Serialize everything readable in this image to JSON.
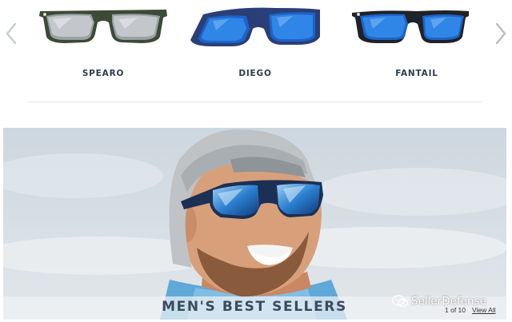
{
  "carousel": {
    "products": [
      {
        "name": "SPEARO",
        "icon": "sunglasses-silver-mirror-green-camo"
      },
      {
        "name": "DIEGO",
        "icon": "sunglasses-blue-mirror-navy"
      },
      {
        "name": "FANTAIL",
        "icon": "sunglasses-blue-mirror-black"
      }
    ],
    "prev_icon": "chevron-left-icon",
    "next_icon": "chevron-right-icon"
  },
  "hero": {
    "title": "MEN'S BEST SELLERS",
    "pagination": "1 of 10",
    "view_all": "View All"
  },
  "watermark": {
    "text": "SellerDefense",
    "icon": "wechat-icon"
  },
  "colors": {
    "label": "#2e3b4e",
    "lens_blue": "#1e63c9",
    "frame_navy": "#2a3f78"
  }
}
